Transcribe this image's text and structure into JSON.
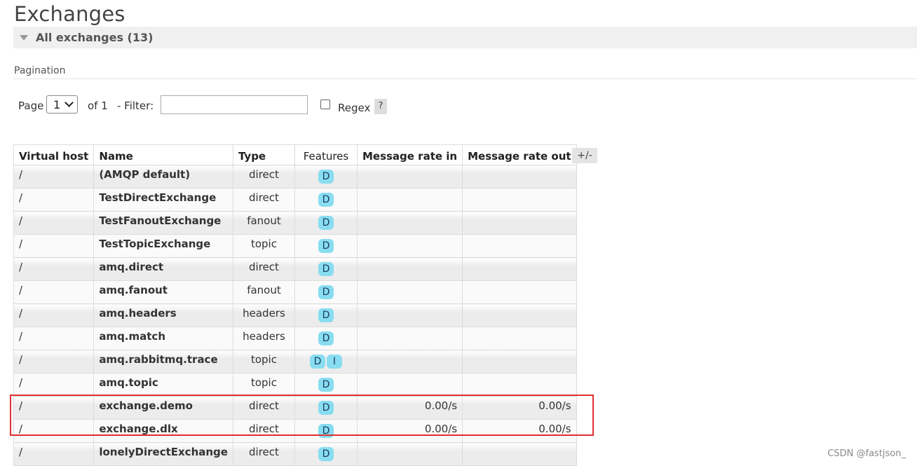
{
  "page": {
    "title": "Exchanges",
    "section_label": "All exchanges (13)",
    "pagination_label": "Pagination",
    "watermark": "CSDN @fastjson_"
  },
  "pagination": {
    "page_label": "Page",
    "page_value": "1",
    "of_label": "of 1",
    "filter_label": "- Filter:",
    "filter_value": "",
    "regex_label": "Regex",
    "regex_checked": false,
    "help_label": "?"
  },
  "table": {
    "columns": [
      "Virtual host",
      "Name",
      "Type",
      "Features",
      "Message rate in",
      "Message rate out"
    ],
    "toggle_label": "+/-",
    "rows": [
      {
        "vhost": "/",
        "name": "(AMQP default)",
        "type": "direct",
        "features": [
          "D"
        ],
        "rate_in": "",
        "rate_out": ""
      },
      {
        "vhost": "/",
        "name": "TestDirectExchange",
        "type": "direct",
        "features": [
          "D"
        ],
        "rate_in": "",
        "rate_out": ""
      },
      {
        "vhost": "/",
        "name": "TestFanoutExchange",
        "type": "fanout",
        "features": [
          "D"
        ],
        "rate_in": "",
        "rate_out": ""
      },
      {
        "vhost": "/",
        "name": "TestTopicExchange",
        "type": "topic",
        "features": [
          "D"
        ],
        "rate_in": "",
        "rate_out": ""
      },
      {
        "vhost": "/",
        "name": "amq.direct",
        "type": "direct",
        "features": [
          "D"
        ],
        "rate_in": "",
        "rate_out": ""
      },
      {
        "vhost": "/",
        "name": "amq.fanout",
        "type": "fanout",
        "features": [
          "D"
        ],
        "rate_in": "",
        "rate_out": ""
      },
      {
        "vhost": "/",
        "name": "amq.headers",
        "type": "headers",
        "features": [
          "D"
        ],
        "rate_in": "",
        "rate_out": ""
      },
      {
        "vhost": "/",
        "name": "amq.match",
        "type": "headers",
        "features": [
          "D"
        ],
        "rate_in": "",
        "rate_out": ""
      },
      {
        "vhost": "/",
        "name": "amq.rabbitmq.trace",
        "type": "topic",
        "features": [
          "D",
          "I"
        ],
        "rate_in": "",
        "rate_out": ""
      },
      {
        "vhost": "/",
        "name": "amq.topic",
        "type": "topic",
        "features": [
          "D"
        ],
        "rate_in": "",
        "rate_out": ""
      },
      {
        "vhost": "/",
        "name": "exchange.demo",
        "type": "direct",
        "features": [
          "D"
        ],
        "rate_in": "0.00/s",
        "rate_out": "0.00/s"
      },
      {
        "vhost": "/",
        "name": "exchange.dlx",
        "type": "direct",
        "features": [
          "D"
        ],
        "rate_in": "0.00/s",
        "rate_out": "0.00/s"
      },
      {
        "vhost": "/",
        "name": "lonelyDirectExchange",
        "type": "direct",
        "features": [
          "D"
        ],
        "rate_in": "",
        "rate_out": ""
      }
    ]
  },
  "colors": {
    "badge": "#88ddf0",
    "highlight": "#e03030"
  }
}
